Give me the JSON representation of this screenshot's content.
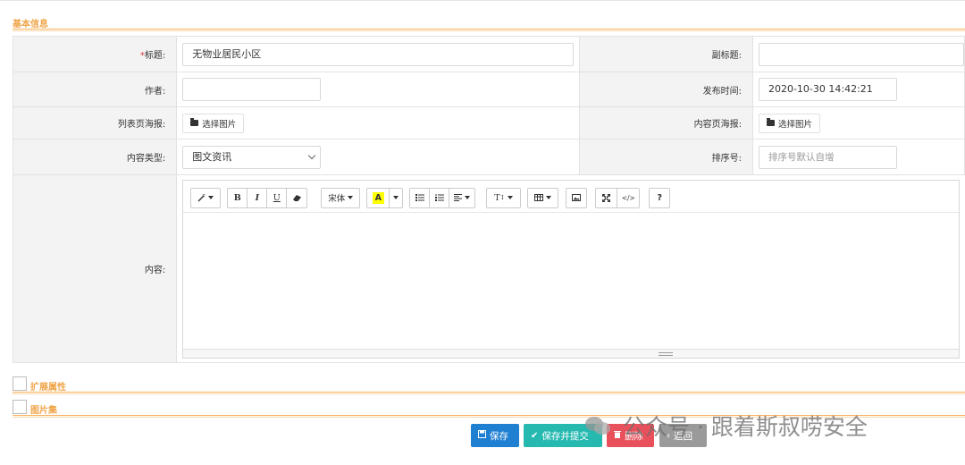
{
  "basic_info": {
    "section_title": "基本信息",
    "title_label": "标题:",
    "title_required_mark": "*",
    "title_value": "无物业居民小区",
    "subtitle_label": "副标题:",
    "subtitle_value": "",
    "author_label": "作者:",
    "author_value": "",
    "publish_time_label": "发布时间:",
    "publish_time_value": "2020-10-30 14:42:21",
    "list_poster_label": "列表页海报:",
    "list_poster_button": "选择图片",
    "content_poster_label": "内容页海报:",
    "content_poster_button": "选择图片",
    "content_type_label": "内容类型:",
    "content_type_selected": "图文资讯",
    "sort_label": "排序号:",
    "sort_placeholder": "排序号默认自增",
    "content_label": "内容:"
  },
  "editor_toolbar": {
    "style_btn": "⁄▾",
    "bold": "B",
    "italic": "I",
    "underline": "U",
    "eraser_icon": "eraser-icon",
    "font_family": "宋体",
    "fore_color": "A",
    "fore_color_hex": "#ffff00",
    "ul_icon": "unordered-list-icon",
    "ol_icon": "ordered-list-icon",
    "align_icon": "align-icon",
    "font_size": "T",
    "table_icon": "table-icon",
    "picture_icon": "picture-icon",
    "fullscreen_icon": "fullscreen-icon",
    "code_view": "</>",
    "help": "?"
  },
  "sections": {
    "extended_attrs": "扩展属性",
    "image_set": "图片集"
  },
  "actions": {
    "save": "保存",
    "save_submit": "保存并提交",
    "delete": "删除",
    "back": "返回",
    "save_color": "#1f7fd1",
    "save_submit_color": "#26b9b0",
    "delete_color": "#e8505b",
    "back_color": "#9a9a9a"
  },
  "watermark": {
    "text": "公众号 · 跟着斯叔唠安全"
  },
  "theme": {
    "accent_orange": "#f0a54a",
    "label_bg": "#f3f3f3",
    "required_red": "#e4393c"
  }
}
